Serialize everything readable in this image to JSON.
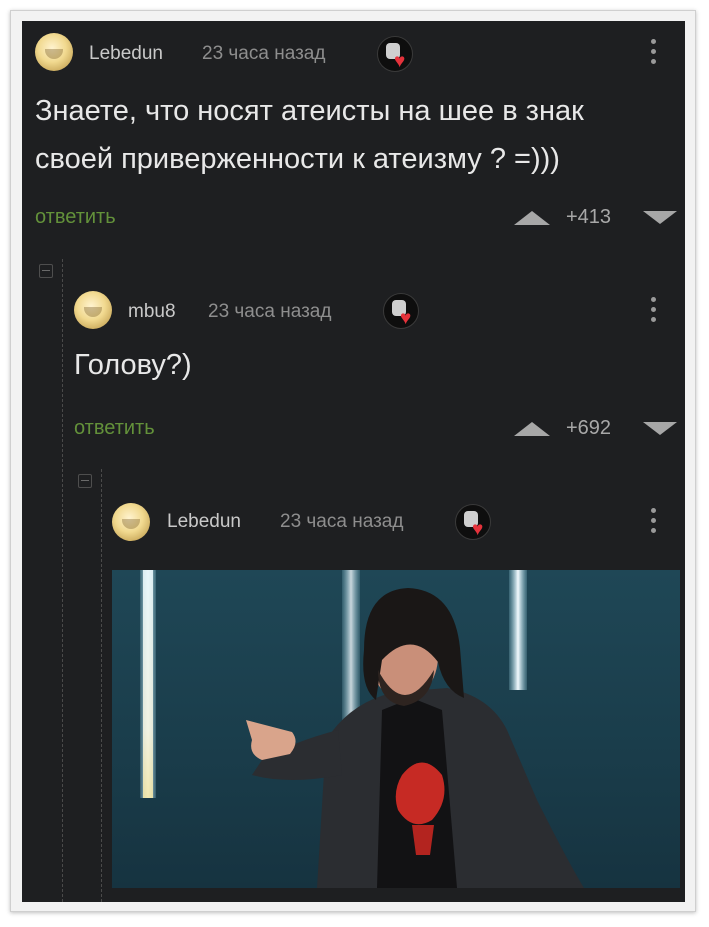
{
  "comments": [
    {
      "username": "Lebedun",
      "timestamp": "23 часа назад",
      "text_line1": "Знаете, что носят атеисты на шее в знак",
      "text_line2": "своей приверженности к атеизму ? =)))",
      "reply_label": "ответить",
      "score": "+413"
    },
    {
      "username": "mbu8",
      "timestamp": "23 часа назад",
      "text_line1": "Голову?)",
      "reply_label": "ответить",
      "score": "+692"
    },
    {
      "username": "Lebedun",
      "timestamp": "23 часа назад",
      "image_description": "photo"
    }
  ],
  "colors": {
    "background": "#1e1f21",
    "reply_link": "#63913a",
    "heart": "#e5323b",
    "text": "#e8e8e8",
    "meta": "#8e8e8e"
  },
  "icons": [
    "avatar",
    "award-heart-icon",
    "more-vertical-icon",
    "upvote-icon",
    "downvote-icon",
    "collapse-thread-icon"
  ]
}
